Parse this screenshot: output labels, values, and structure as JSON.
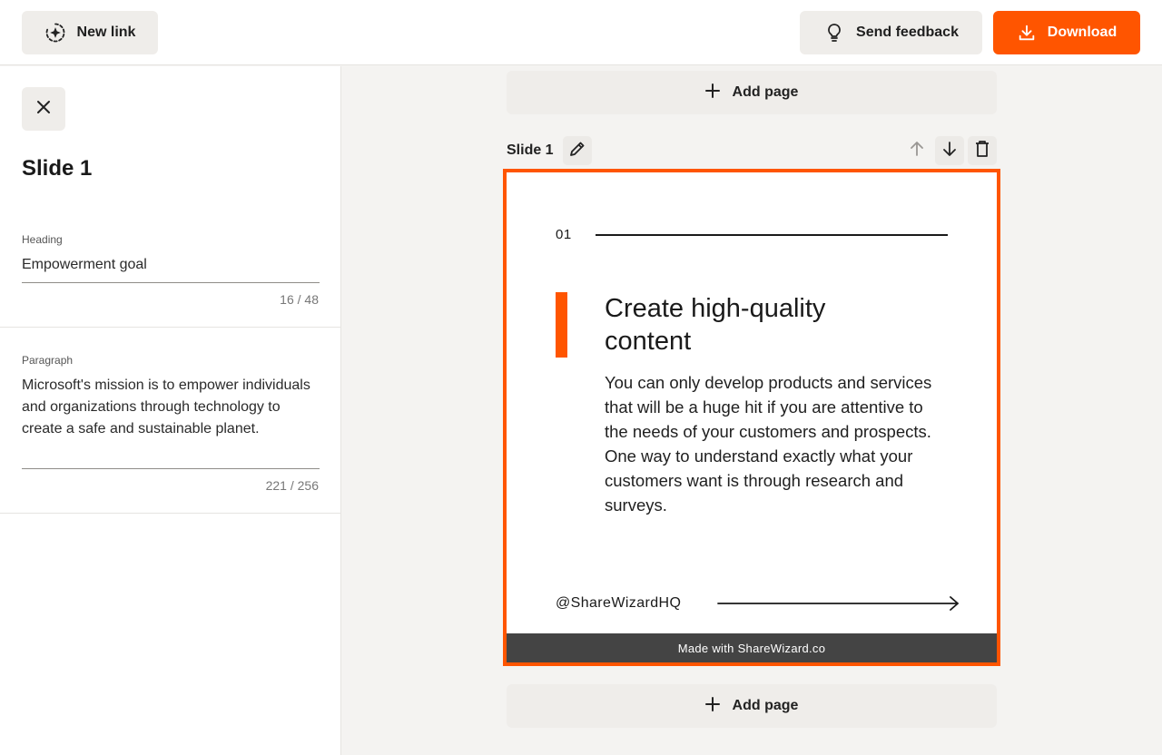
{
  "toolbar": {
    "new_link_label": "New link",
    "feedback_label": "Send feedback",
    "download_label": "Download",
    "accent_color": "#ff5500"
  },
  "sidebar": {
    "title": "Slide 1",
    "heading": {
      "label": "Heading",
      "value": "Empowerment goal",
      "count": "16 / 48"
    },
    "paragraph": {
      "label": "Paragraph",
      "value": "Microsoft's mission is to empower individuals and organizations through technology to create a safe and sustainable planet.",
      "count": "221 / 256"
    }
  },
  "canvas": {
    "add_page_label": "Add page",
    "slide_label": "Slide 1",
    "slide": {
      "number": "01",
      "heading": "Create high-quality content",
      "paragraph": "You can only develop products and services that will be a huge hit if you are attentive to the needs of your customers and prospects. One way to understand exactly what your customers want is through research and surveys.",
      "handle": "@ShareWizardHQ",
      "footer": "Made with ShareWizard.co"
    }
  },
  "icons": {
    "new_link": "sparkle-circle-icon",
    "feedback": "lightbulb-icon",
    "download": "download-icon",
    "close": "close-icon",
    "edit": "pencil-icon",
    "move_up": "arrow-up-icon",
    "move_down": "arrow-down-icon",
    "delete": "trash-icon",
    "add": "plus-icon"
  }
}
